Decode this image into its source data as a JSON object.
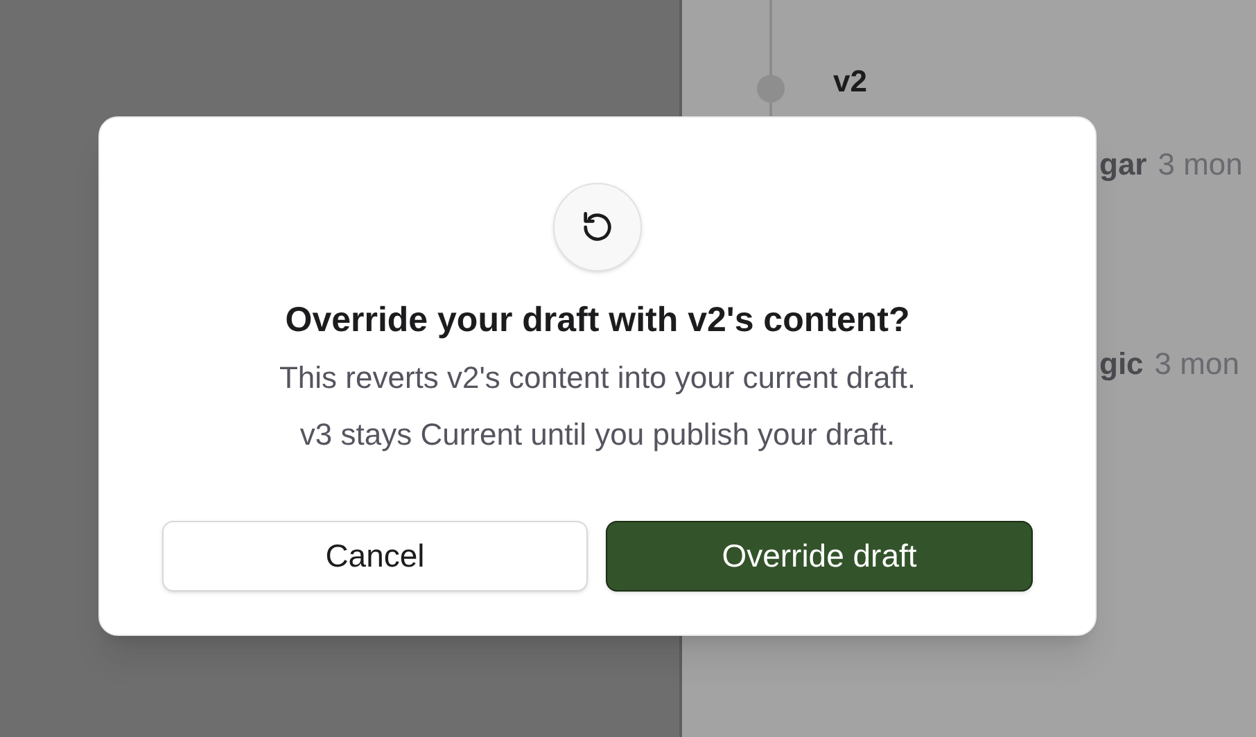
{
  "background": {
    "version_label": "v2",
    "rows": [
      {
        "column_1": "gar",
        "column_2": "3 mon"
      },
      {
        "column_1": "gic",
        "column_2": "3 mon"
      }
    ]
  },
  "dialog": {
    "title": "Override your draft with v2's content?",
    "message": [
      "This reverts v2's content into your current draft.",
      "v3 stays Current until you publish your draft."
    ],
    "buttons": [
      {
        "label": "Cancel",
        "kind": "secondary"
      },
      {
        "label": "Override draft",
        "kind": "primary"
      }
    ]
  }
}
